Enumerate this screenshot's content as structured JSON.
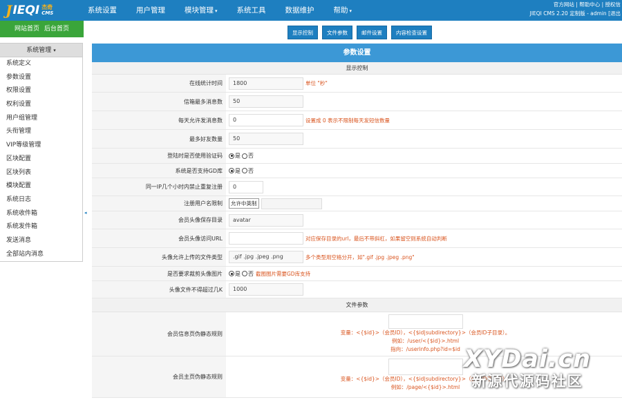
{
  "logo": {
    "mark": "J",
    "word": "IEQI",
    "cn": "杰奇",
    "en": "CMS"
  },
  "topnav": [
    {
      "label": "系统设置",
      "caret": ""
    },
    {
      "label": "用户管理",
      "caret": ""
    },
    {
      "label": "模块管理",
      "caret": "▾"
    },
    {
      "label": "系统工具",
      "caret": ""
    },
    {
      "label": "数据维护",
      "caret": ""
    },
    {
      "label": "帮助",
      "caret": "▾"
    }
  ],
  "topright": {
    "links": [
      "官方网站",
      "帮助中心",
      "授权信"
    ],
    "version": "JIEQI CMS 2.20 定制版 - admin [退出"
  },
  "home_bar": {
    "site_home": "网站首页",
    "admin_home": "后台首页"
  },
  "sidebar": {
    "title": "系统管理",
    "caret": "▾",
    "items": [
      "系统定义",
      "参数设置",
      "权限设置",
      "权利设置",
      "用户组管理",
      "头衔管理",
      "VIP等级管理",
      "区块配置",
      "区块列表",
      "模块配置",
      "系统日志",
      "系统收件箱",
      "系统发件箱",
      "发送消息",
      "全部站内消息"
    ],
    "collapse_glyph": "◂"
  },
  "tabs": [
    "显示控制",
    "文件参数",
    "邮件设置",
    "内容检查设置"
  ],
  "panel": {
    "title": "参数设置",
    "section_display": "显示控制",
    "section_files": "文件参数",
    "rows": {
      "online_time": {
        "label": "在线统计时间",
        "value": "1800",
        "hint": "单位 \"秒\""
      },
      "max_messages": {
        "label": "信箱最多消息数",
        "value": "50"
      },
      "daily_messages": {
        "label": "每天允许发消息数",
        "value": "0",
        "hint": "设置成 0 表示不限制每天发短信数量"
      },
      "max_friends": {
        "label": "最多好友数量",
        "value": "50"
      },
      "login_captcha": {
        "label": "登陆时是否使用验证码",
        "yes": "是",
        "no": "否"
      },
      "gd_support": {
        "label": "系统是否支持GD库",
        "yes": "是",
        "no": "否"
      },
      "ip_limit": {
        "label": "同一IP几个小时内禁止重复注册",
        "value": "0"
      },
      "username_limit": {
        "label": "注册用户名限制",
        "value": "允许中英制"
      },
      "avatar_dir": {
        "label": "会员头像保存目录",
        "value": "avatar"
      },
      "avatar_url": {
        "label": "会员头像访问URL",
        "value": "",
        "hint": "对应保存目录的url，最后不带斜杠，如果留空则系统自动判断"
      },
      "avatar_types": {
        "label": "头像允许上传的文件类型",
        "value": ".gif .jpg .jpeg .png",
        "hint": "多个类型用空格分开，如\".gif .jpg .jpeg .png\""
      },
      "avatar_crop": {
        "label": "是否要求裁剪头像图片",
        "yes": "是",
        "no": "否",
        "hint": "截图图片需要GD库支持"
      },
      "avatar_size": {
        "label": "头像文件不得超过几K",
        "value": "1000"
      },
      "member_info_rule": {
        "label": "会员信息页伪静态规则",
        "notes": [
          "变量：<{$id}>（会员ID），<{$id|subdirectory}>（会员ID子目录）。",
          "例如：/user/<{$id}>.html",
          "指向：/userinfo.php?id=$id"
        ]
      },
      "member_home_rule": {
        "label": "会员主页伪静态规则",
        "notes": [
          "变量：<{$id}>（会员ID），<{$id|subdirectory}>（会员ID子目录）。",
          "例如：/page/<{$id}>.html"
        ]
      }
    }
  },
  "watermark": {
    "main": "XYDai.cn",
    "sub": "新源代源码社区"
  },
  "colors": {
    "topbar": "#1e7fc0",
    "home_bar": "#3aa53a",
    "panel_title": "#3c98d6",
    "hint": "#d9541e"
  }
}
